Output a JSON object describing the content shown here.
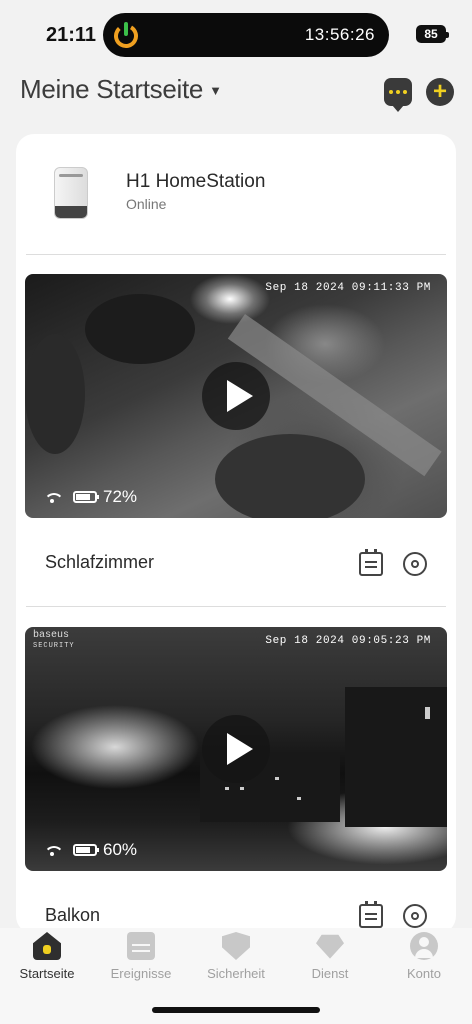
{
  "status_bar": {
    "time": "21:11",
    "island_clock": "13:56:26",
    "battery": "85"
  },
  "header": {
    "title": "Meine Startseite",
    "icons": [
      "message-icon",
      "plus-icon"
    ]
  },
  "homestation": {
    "name": "H1 HomeStation",
    "status": "Online"
  },
  "cameras": [
    {
      "name": "Schlafzimmer",
      "timestamp": "Sep 18 2024 09:11:33 PM",
      "battery_percent": "72%",
      "battery_level": 0.72
    },
    {
      "name": "Balkon",
      "timestamp": "Sep 18 2024 09:05:23 PM",
      "battery_percent": "60%",
      "battery_level": 0.6,
      "brand": "baseus",
      "brand_sub": "SECURITY"
    }
  ],
  "tabs": [
    {
      "label": "Startseite",
      "icon": "home-icon",
      "active": true
    },
    {
      "label": "Ereignisse",
      "icon": "calendar-icon",
      "active": false
    },
    {
      "label": "Sicherheit",
      "icon": "shield-icon",
      "active": false
    },
    {
      "label": "Dienst",
      "icon": "service-icon",
      "active": false
    },
    {
      "label": "Konto",
      "icon": "account-icon",
      "active": false
    }
  ],
  "colors": {
    "accent": "#f0d020",
    "background": "#f2f2f2",
    "card": "#ffffff"
  }
}
